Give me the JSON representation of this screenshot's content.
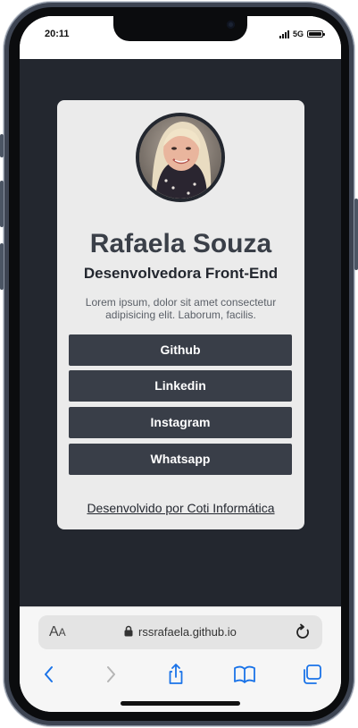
{
  "status_bar": {
    "time": "20:11",
    "network": "5G"
  },
  "profile": {
    "name": "Rafaela Souza",
    "role": "Desenvolvedora Front-End",
    "bio": "Lorem ipsum, dolor sit amet consectetur adipisicing elit. Laborum, facilis."
  },
  "links": [
    {
      "label": "Github"
    },
    {
      "label": "Linkedin"
    },
    {
      "label": "Instagram"
    },
    {
      "label": "Whatsapp"
    }
  ],
  "footer": {
    "credit": "Desenvolvido por Coti Informática"
  },
  "browser": {
    "text_size_big": "A",
    "text_size_small": "A",
    "url": "rssrafaela.github.io"
  },
  "colors": {
    "page_background": "#23272f",
    "card_background": "#ebebeb",
    "button_background": "#393e48",
    "safari_accent": "#1a73e8"
  },
  "icons": [
    "signal-icon",
    "battery-icon",
    "lock-icon",
    "reload-icon",
    "back-icon",
    "forward-icon",
    "share-icon",
    "bookmarks-icon",
    "tabs-icon"
  ]
}
